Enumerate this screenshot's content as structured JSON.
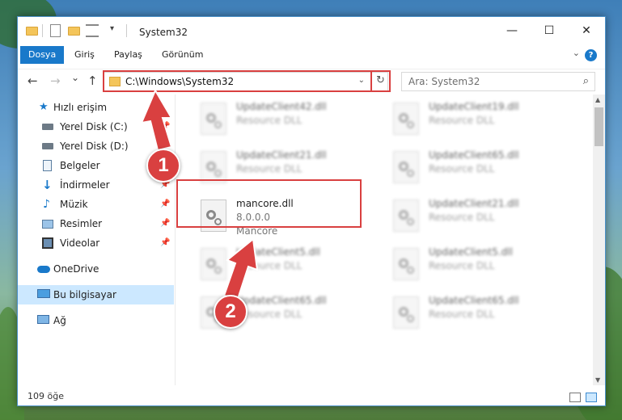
{
  "window": {
    "title": "System32",
    "minimize": "—",
    "maximize": "☐",
    "close": "✕"
  },
  "ribbon": {
    "tabs": [
      "Dosya",
      "Giriş",
      "Paylaş",
      "Görünüm"
    ],
    "help": "?"
  },
  "nav": {
    "back": "←",
    "forward": "→",
    "recent": "⌄",
    "up": "↑",
    "address": "C:\\Windows\\System32",
    "refresh": "↻",
    "search_placeholder": "Ara: System32"
  },
  "sidebar": {
    "items": [
      {
        "label": "Hızlı erişim",
        "icon": "star-icon"
      },
      {
        "label": "Yerel Disk (C:)",
        "icon": "drive-icon"
      },
      {
        "label": "Yerel Disk (D:)",
        "icon": "drive-icon"
      },
      {
        "label": "Belgeler",
        "icon": "documents-icon"
      },
      {
        "label": "İndirmeler",
        "icon": "download-icon"
      },
      {
        "label": "Müzik",
        "icon": "music-icon"
      },
      {
        "label": "Resimler",
        "icon": "pictures-icon"
      },
      {
        "label": "Videolar",
        "icon": "videos-icon"
      },
      {
        "label": "OneDrive",
        "icon": "cloud-icon"
      },
      {
        "label": "Bu bilgisayar",
        "icon": "computer-icon"
      },
      {
        "label": "Ağ",
        "icon": "network-icon"
      }
    ]
  },
  "files": [
    {
      "name": "UpdateClient42.dll",
      "desc": "Resource DLL"
    },
    {
      "name": "UpdateClient19.dll",
      "desc": "Resource DLL"
    },
    {
      "name": "UpdateClient21.dll",
      "desc": "Resource DLL"
    },
    {
      "name": "UpdateClient65.dll",
      "desc": "Resource DLL"
    },
    {
      "name": "mancore.dll",
      "version": "8.0.0.0",
      "desc": "Mancore"
    },
    {
      "name": "UpdateClient21.dll",
      "desc": "Resource DLL"
    },
    {
      "name": "UpdateClient5.dll",
      "desc": "Resource DLL"
    },
    {
      "name": "UpdateClient5.dll",
      "desc": "Resource DLL"
    },
    {
      "name": "UpdateClient65.dll",
      "desc": "Resource DLL"
    },
    {
      "name": "UpdateClient65.dll",
      "desc": "Resource DLL"
    }
  ],
  "status": {
    "count": "109 öğe"
  },
  "annotations": {
    "badge1": "1",
    "badge2": "2",
    "color": "#d94040"
  }
}
